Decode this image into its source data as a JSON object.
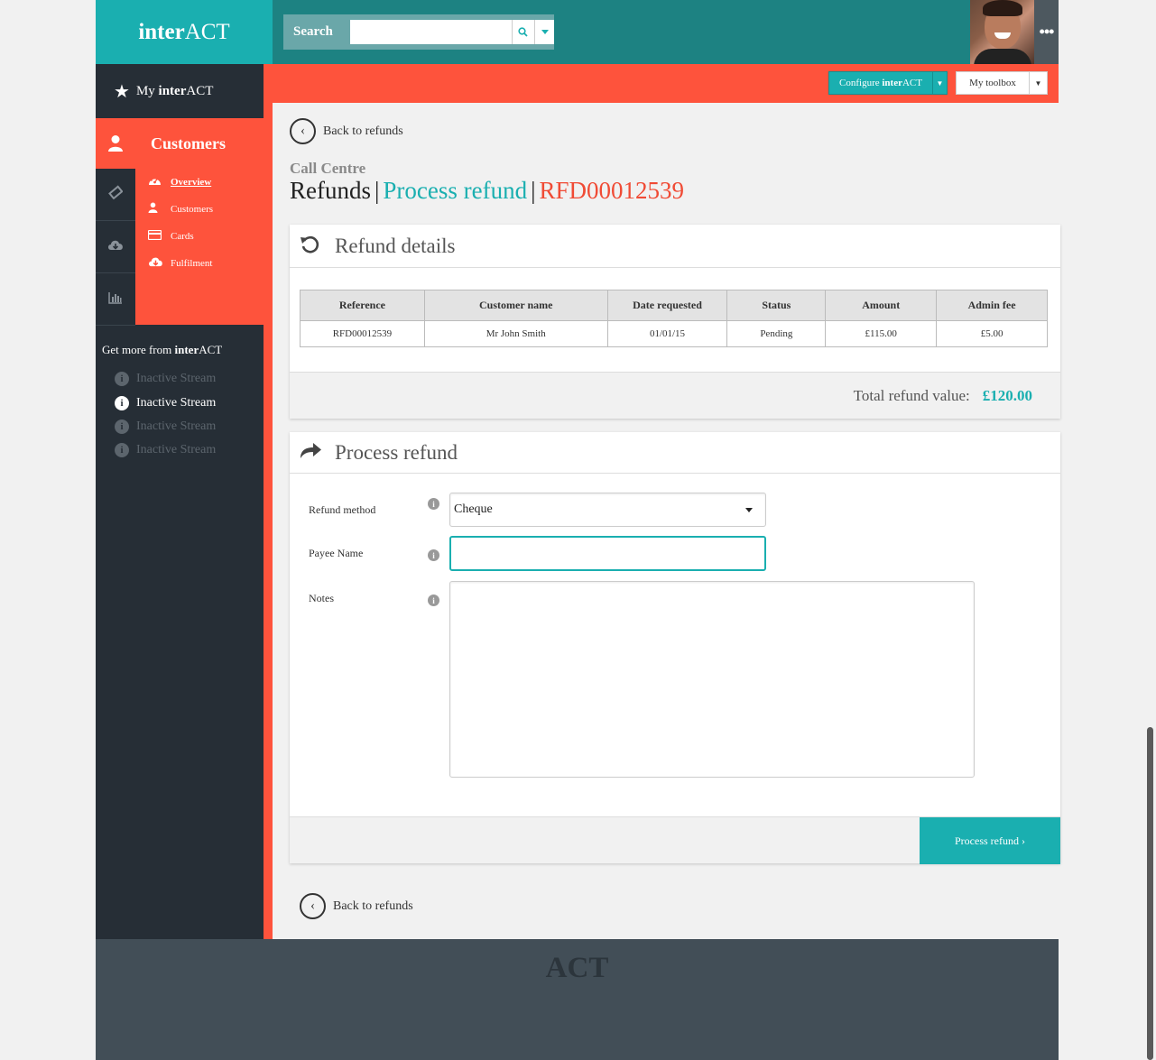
{
  "header": {
    "logo_bold": "inter",
    "logo_rest": "ACT",
    "search_label": "Search",
    "search_placeholder": "",
    "more_label": "•••"
  },
  "actionbar": {
    "configure_prefix": "Configure ",
    "configure_bold": "inter",
    "configure_rest": "ACT",
    "toolbox_label": "My toolbox"
  },
  "sidebar": {
    "my_prefix": "My ",
    "my_bold": "inter",
    "my_rest": "ACT",
    "section_title": "Customers",
    "subnav": [
      {
        "label": "Overview",
        "icon": "dashboard-icon"
      },
      {
        "label": "Customers",
        "icon": "user-icon"
      },
      {
        "label": "Cards",
        "icon": "card-icon"
      },
      {
        "label": "Fulfilment",
        "icon": "cloud-download-icon"
      }
    ],
    "getmore_prefix": "Get more from ",
    "getmore_bold": "inter",
    "getmore_rest": "ACT",
    "streams": [
      {
        "label": "Inactive Stream",
        "active": false
      },
      {
        "label": "Inactive Stream",
        "active": true
      },
      {
        "label": "Inactive Stream",
        "active": false
      },
      {
        "label": "Inactive Stream",
        "active": false
      }
    ]
  },
  "main": {
    "back_label": "Back to refunds",
    "section": "Call Centre",
    "crumb_refunds": "Refunds",
    "crumb_sep": "|",
    "crumb_process": "Process refund",
    "crumb_ref": "RFD00012539",
    "details": {
      "title": "Refund details",
      "columns": [
        "Reference",
        "Customer name",
        "Date requested",
        "Status",
        "Amount",
        "Admin fee"
      ],
      "rows": [
        [
          "RFD00012539",
          "Mr John Smith",
          "01/01/15",
          "Pending",
          "£115.00",
          "£5.00"
        ]
      ],
      "total_label": "Total refund value:",
      "total_value": "£120.00"
    },
    "process": {
      "title": "Process refund",
      "method_label": "Refund method",
      "method_value": "Cheque",
      "payee_label": "Payee Name",
      "payee_value": "",
      "notes_label": "Notes",
      "notes_value": "",
      "submit_label": "Process refund ›"
    },
    "back_label_bottom": "Back to refunds"
  },
  "footer": {
    "logo": "ACT"
  },
  "colors": {
    "teal": "#1aafb0",
    "dark_teal": "#1d8282",
    "orange": "#fe533c",
    "ref_red": "#f04b35",
    "sidebar_dark": "#262e36",
    "footer": "#424e57"
  }
}
